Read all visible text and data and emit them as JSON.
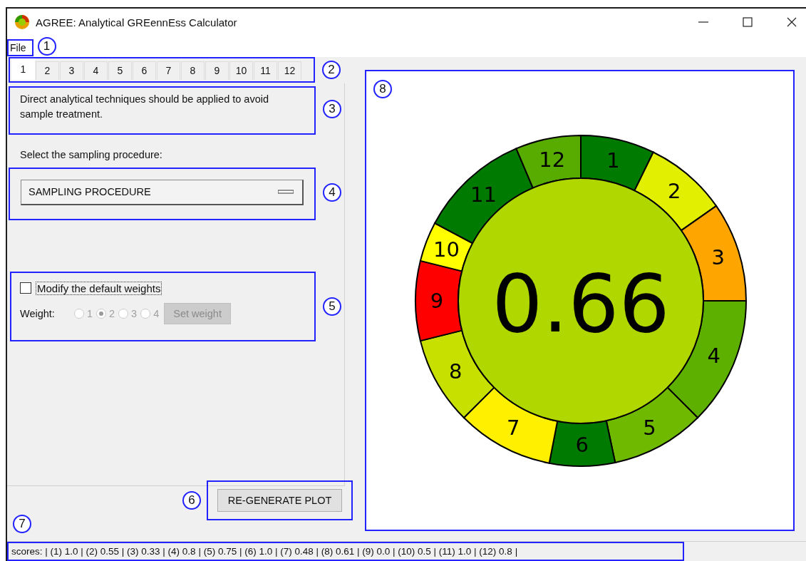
{
  "window": {
    "title": "AGREE: Analytical GREennEss Calculator"
  },
  "menu": {
    "items": [
      {
        "label": "File"
      }
    ],
    "annotation": "1"
  },
  "tabs": {
    "annotation": "2",
    "items": [
      {
        "label": "1",
        "selected": true
      },
      {
        "label": "2",
        "selected": false
      },
      {
        "label": "3",
        "selected": false
      },
      {
        "label": "4",
        "selected": false
      },
      {
        "label": "5",
        "selected": false
      },
      {
        "label": "6",
        "selected": false
      },
      {
        "label": "7",
        "selected": false
      },
      {
        "label": "8",
        "selected": false
      },
      {
        "label": "9",
        "selected": false
      },
      {
        "label": "10",
        "selected": false
      },
      {
        "label": "11",
        "selected": false
      },
      {
        "label": "12",
        "selected": false
      }
    ]
  },
  "principle": {
    "text": "Direct analytical techniques should be applied to avoid sample treatment.",
    "annotation": "3"
  },
  "sampling": {
    "label": "Select the sampling procedure:",
    "dropdown": "SAMPLING PROCEDURE",
    "annotation": "4"
  },
  "weights": {
    "annotation": "5",
    "checkbox": {
      "label": "Modify the default weights",
      "checked": false
    },
    "label": "Weight:",
    "disabled": true,
    "options": [
      {
        "label": "1",
        "selected": false
      },
      {
        "label": "2",
        "selected": true
      },
      {
        "label": "3",
        "selected": false
      },
      {
        "label": "4",
        "selected": false
      }
    ],
    "button": "Set weight"
  },
  "regenerate": {
    "label": "RE-GENERATE PLOT",
    "annotation": "6"
  },
  "status_bar": {
    "annotation": "7",
    "text": "scores: | (1) 1.0 | (2) 0.55 | (3) 0.33 | (4) 0.8 | (5) 0.75 | (6) 1.0 | (7) 0.48 | (8) 0.61 | (9) 0.0 | (10) 0.5 | (11) 1.0 | (12) 0.8 |"
  },
  "plot": {
    "annotation": "8",
    "score": "0.66",
    "segments": [
      {
        "label": "1",
        "color": "#007a00"
      },
      {
        "label": "2",
        "color": "#e3ef00"
      },
      {
        "label": "3",
        "color": "#ffa500"
      },
      {
        "label": "4",
        "color": "#5db000"
      },
      {
        "label": "5",
        "color": "#6fba00"
      },
      {
        "label": "6",
        "color": "#007a00"
      },
      {
        "label": "7",
        "color": "#fff000"
      },
      {
        "label": "8",
        "color": "#c8e000"
      },
      {
        "label": "9",
        "color": "#ff0000"
      },
      {
        "label": "10",
        "color": "#ffff00"
      },
      {
        "label": "11",
        "color": "#007a00"
      },
      {
        "label": "12",
        "color": "#58ac00"
      }
    ]
  }
}
